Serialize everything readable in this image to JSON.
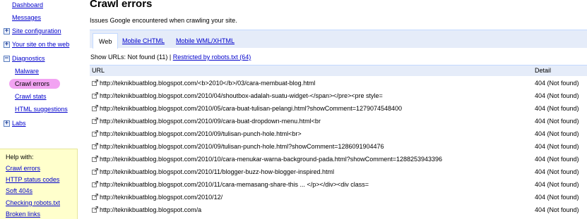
{
  "sidebar": {
    "nav": [
      {
        "label": "Dashboard",
        "expander": ""
      },
      {
        "label": "Messages",
        "expander": ""
      },
      {
        "label": "Site configuration",
        "expander": "+"
      },
      {
        "label": "Your site on the web",
        "expander": "+"
      },
      {
        "label": "Diagnostics",
        "expander": "−"
      },
      {
        "label": "Malware",
        "expander": ""
      },
      {
        "label": "Crawl errors",
        "expander": "",
        "active": true
      },
      {
        "label": "Crawl stats",
        "expander": ""
      },
      {
        "label": "HTML suggestions",
        "expander": ""
      },
      {
        "label": "Labs",
        "expander": "+"
      }
    ],
    "help": {
      "title": "Help with:",
      "links": [
        "Crawl errors",
        "HTTP status codes",
        "Soft 404s",
        "Checking robots.txt",
        "Broken links"
      ]
    }
  },
  "main": {
    "title": "Crawl errors",
    "description": "Issues Google encountered when crawling your site.",
    "tabs": [
      {
        "label": "Web",
        "selected": true
      },
      {
        "label": "Mobile CHTML",
        "selected": false
      },
      {
        "label": "Mobile WML/XHTML",
        "selected": false
      }
    ],
    "filter": {
      "prefix": "Show URLs: Not found (11) | ",
      "link": "Restricted by robots.txt (64)"
    },
    "table": {
      "headers": {
        "url": "URL",
        "detail": "Detail"
      },
      "rows": [
        {
          "url": "http://teknikbuatblog.blogspot.com/<b>2010</b>/03/cara-membuat-blog.html",
          "detail": "404 (Not found)"
        },
        {
          "url": "http://teknikbuatblog.blogspot.com/2010/04/shoutbox-adalah-suatu-widget-</span></pre><pre style=",
          "detail": "404 (Not found)"
        },
        {
          "url": "http://teknikbuatblog.blogspot.com/2010/05/cara-buat-tulisan-pelangi.html?showComment=1279074548400",
          "detail": "404 (Not found)"
        },
        {
          "url": "http://teknikbuatblog.blogspot.com/2010/09/cara-buat-dropdown-menu.html<br",
          "detail": "404 (Not found)"
        },
        {
          "url": "http://teknikbuatblog.blogspot.com/2010/09/tulisan-punch-hole.html<br>",
          "detail": "404 (Not found)"
        },
        {
          "url": "http://teknikbuatblog.blogspot.com/2010/09/tulisan-punch-hole.html?showComment=1286091904476",
          "detail": "404 (Not found)"
        },
        {
          "url": "http://teknikbuatblog.blogspot.com/2010/10/cara-menukar-warna-background-pada.html?showComment=1288253943396",
          "detail": "404 (Not found)"
        },
        {
          "url": "http://teknikbuatblog.blogspot.com/2010/11/blogger-buzz-how-blogger-inspired.html",
          "detail": "404 (Not found)"
        },
        {
          "url": "http://teknikbuatblog.blogspot.com/2010/11/cara-memasang-share-this   ...  </p></div><div class=",
          "detail": "404 (Not found)"
        },
        {
          "url": "http://teknikbuatblog.blogspot.com/2010/12/",
          "detail": "404 (Not found)"
        },
        {
          "url": "http://teknikbuatblog.blogspot.com/a",
          "detail": "404 (Not found)"
        }
      ]
    }
  },
  "colors": {
    "link": "#0000cc",
    "tab_bar": "#e5ecf9",
    "border": "#c3d9ff",
    "active_highlight": "#f2a3f2",
    "help_bg": "#ffffcc"
  },
  "icons": {
    "expander": "plus-minus-box-icon",
    "row": "external-link-icon"
  }
}
